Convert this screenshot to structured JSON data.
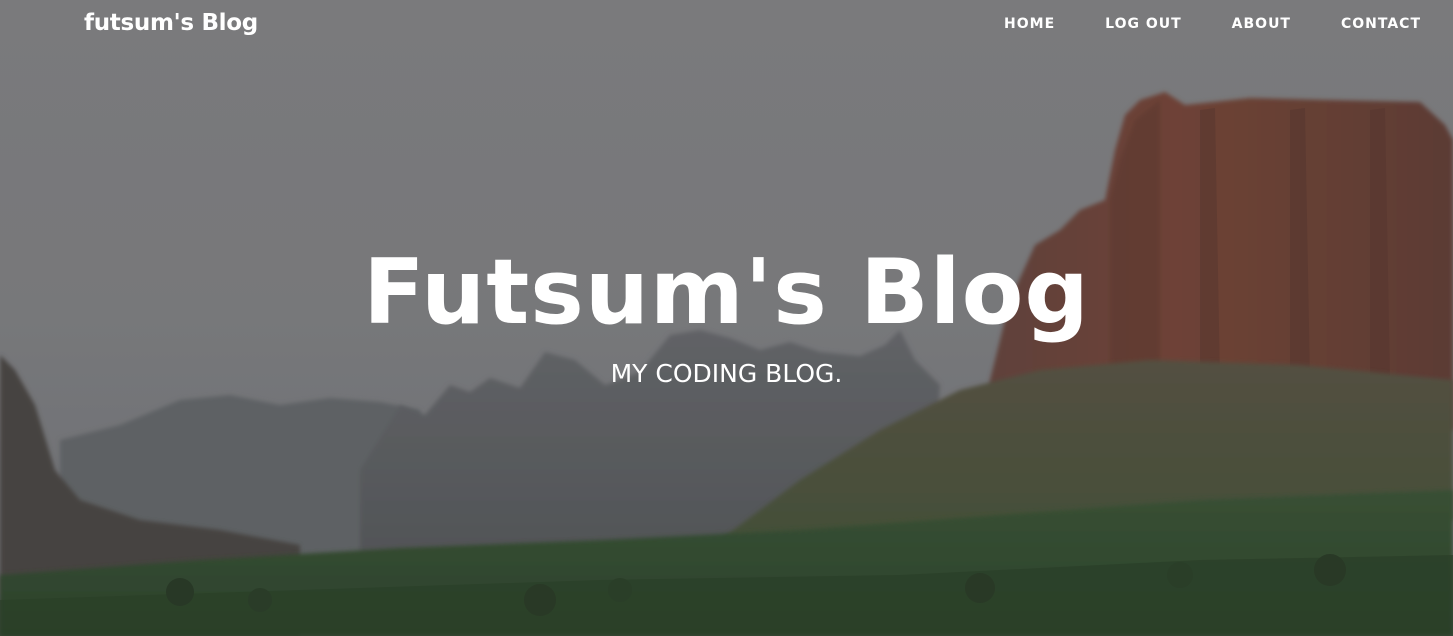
{
  "navbar": {
    "brand": "futsum's Blog",
    "links": [
      {
        "label": "HOME"
      },
      {
        "label": "LOG OUT"
      },
      {
        "label": "ABOUT"
      },
      {
        "label": "CONTACT"
      }
    ]
  },
  "header": {
    "title": "Futsum's Blog",
    "subtitle": "MY CODING BLOG."
  },
  "colors": {
    "text": "#ffffff",
    "sky": "#8f8f90",
    "cliff": "#7a4b3a",
    "grass": "#3f6b3a"
  }
}
